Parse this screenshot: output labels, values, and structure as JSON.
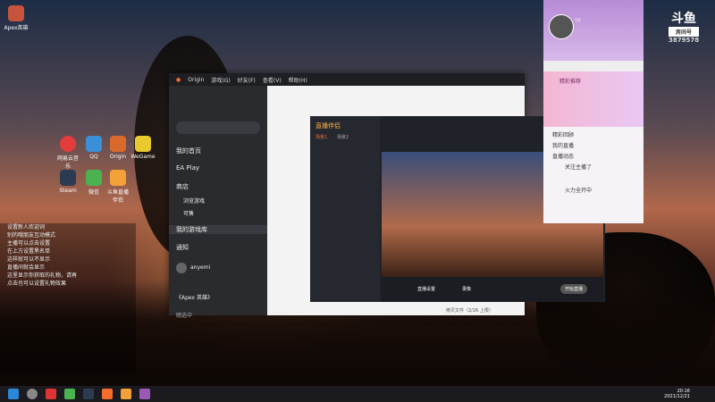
{
  "origin": {
    "title": "Origin",
    "menu": [
      "游戏(G)",
      "好友(F)",
      "查看(V)",
      "帮助(H)"
    ],
    "nav": [
      "我的首页",
      "EA Play",
      "商店",
      "浏览游戏",
      "可售",
      "我的游戏库",
      "通知"
    ],
    "user_name": "anyemi",
    "game_name": "《Apex 英雄》",
    "footer": "随选中",
    "download_status": "拷贝文件（2/26 上限）",
    "streamer_app": {
      "brand": "直播伴侣",
      "tabs": [
        "场景1",
        "场景2"
      ],
      "controls": [
        "直播设置",
        "录像",
        "开始直播"
      ]
    }
  },
  "desktop_icons": [
    "Apex英雄",
    "QQ",
    "Origin",
    "WeGame",
    "Steam",
    "网易云音乐",
    "微信",
    "斗鱼直播伴侣"
  ],
  "chat_log": [
    "设置新人欢迎词",
    "",
    "别的哦朋友互动模式",
    "主播可以点击设置",
    "在上方设置黑名单",
    "这样就可以不显示",
    "直播间就会显示",
    "",
    "这里显示你获取的礼物，请再",
    "点击也可以设置礼物效果"
  ],
  "douyu_panel": {
    "logo_line1": "斗鱼",
    "logo_line2": "房间号",
    "room_id": "3879578",
    "level_label": "LV",
    "banner_text": "精彩推荐",
    "list": [
      "精彩回顾",
      "我的直播",
      "直播动态",
      "关注主播了",
      "火力全开中"
    ]
  },
  "taskbar": {
    "time": "20:16",
    "date": "2021/12/21"
  },
  "colors": {
    "origin_orange": "#f56c2d",
    "douyu_purple": "#b78bd6",
    "taskbar": "#1b1b1f"
  }
}
